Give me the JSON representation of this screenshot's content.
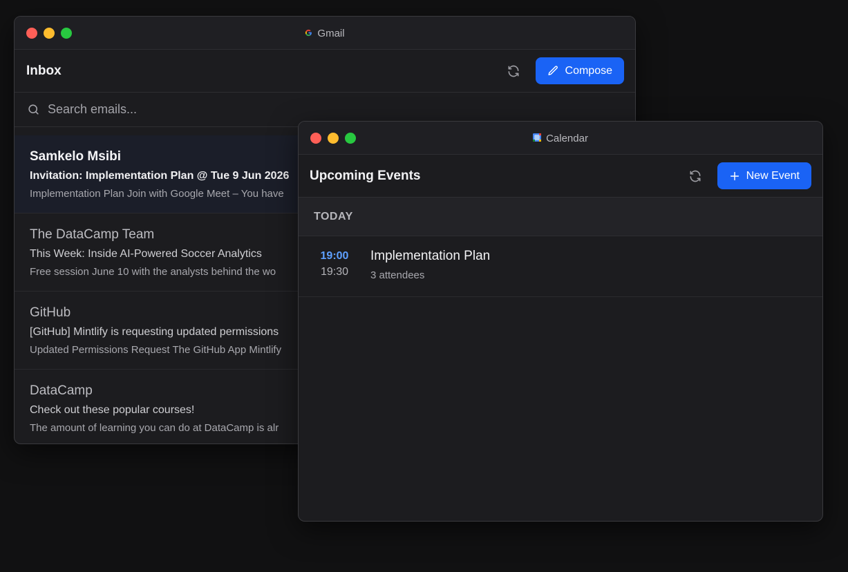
{
  "gmail": {
    "window_title": "Gmail",
    "app_icon": "google-g-icon",
    "header_title": "Inbox",
    "refresh_icon": "refresh-icon",
    "compose_label": "Compose",
    "search_placeholder": "Search emails...",
    "emails": [
      {
        "sender": "Samkelo Msibi",
        "subject": "Invitation: Implementation Plan @ Tue 9 Jun 2026",
        "snippet": "Implementation Plan Join with Google Meet – You have",
        "selected": true
      },
      {
        "sender": "The DataCamp Team",
        "subject": "This Week: Inside AI-Powered Soccer Analytics",
        "snippet": "Free session June 10 with the analysts behind the wo",
        "selected": false
      },
      {
        "sender": "GitHub",
        "subject": "[GitHub] Mintlify is requesting updated permissions",
        "snippet": "Updated Permissions Request The GitHub App Mintlify",
        "selected": false
      },
      {
        "sender": "DataCamp",
        "subject": "Check out these popular courses!",
        "snippet": "The amount of learning you can do at DataCamp is alr",
        "selected": false
      }
    ]
  },
  "calendar": {
    "window_title": "Calendar",
    "app_icon": "google-calendar-icon",
    "header_title": "Upcoming Events",
    "new_event_label": "New Event",
    "section_label": "TODAY",
    "events": [
      {
        "start": "19:00",
        "end": "19:30",
        "title": "Implementation Plan",
        "attendees": "3 attendees"
      }
    ]
  },
  "colors": {
    "accent": "#1a63f5",
    "event_time": "#5ea0ff",
    "background": "#111112",
    "window": "#1c1c1f"
  }
}
